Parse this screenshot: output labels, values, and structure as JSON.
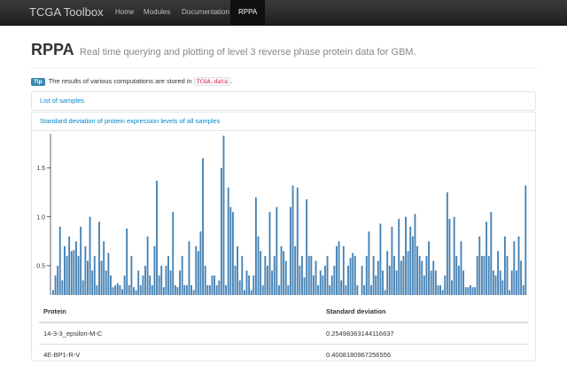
{
  "navbar": {
    "brand": "TCGA Toolbox",
    "items": [
      "Home",
      "Modules",
      "Documentation",
      "RPPA"
    ],
    "active": "RPPA"
  },
  "header": {
    "title": "RPPA",
    "subtitle": "Real time querying and plotting of level 3 reverse phase protein data for GBM."
  },
  "tip": {
    "label": "Tip",
    "text_before": "The results of various computations are stored in",
    "code": "TCGA.data",
    "text_after": "."
  },
  "accordion": {
    "samples_link": "List of samples",
    "stddev_link": "Standard deviation of protein expression levels of all samples"
  },
  "colors": {
    "bar": "#4682b4",
    "link": "#0088cc",
    "navbar": "#222222"
  },
  "chart_data": {
    "type": "bar",
    "title": "",
    "xlabel": "",
    "ylabel": "",
    "ylim": [
      0.2,
      1.85
    ],
    "yticks": [
      "0.5",
      "1.0",
      "1.5"
    ],
    "ytick_values": [
      0.5,
      1.0,
      1.5
    ],
    "values": [
      0.25,
      0.4,
      0.5,
      0.9,
      0.35,
      0.7,
      0.6,
      0.8,
      0.65,
      0.66,
      0.75,
      0.6,
      0.9,
      0.35,
      0.7,
      0.55,
      1.0,
      0.45,
      0.6,
      0.3,
      0.95,
      0.55,
      0.75,
      0.45,
      0.63,
      0.4,
      0.28,
      0.3,
      0.32,
      0.3,
      0.26,
      0.4,
      0.88,
      0.3,
      0.6,
      0.28,
      0.25,
      0.45,
      0.3,
      0.4,
      0.5,
      0.8,
      0.4,
      0.3,
      0.7,
      1.37,
      0.4,
      0.5,
      0.28,
      0.5,
      0.6,
      0.45,
      1.05,
      0.3,
      0.28,
      0.45,
      0.6,
      0.3,
      0.3,
      0.75,
      0.3,
      0.25,
      0.7,
      0.65,
      0.85,
      1.6,
      0.5,
      0.3,
      0.3,
      0.4,
      0.4,
      0.3,
      0.35,
      1.5,
      1.83,
      0.3,
      1.3,
      1.1,
      1.05,
      0.5,
      0.7,
      0.35,
      0.6,
      0.25,
      0.45,
      0.4,
      0.25,
      0.4,
      1.2,
      0.8,
      0.65,
      0.3,
      0.6,
      0.5,
      1.05,
      0.45,
      0.6,
      1.1,
      0.3,
      0.7,
      0.65,
      0.55,
      0.3,
      1.1,
      1.32,
      0.7,
      1.3,
      0.5,
      0.6,
      0.38,
      1.18,
      0.6,
      0.6,
      0.4,
      0.55,
      0.3,
      0.45,
      0.4,
      0.5,
      0.6,
      0.3,
      0.4,
      0.5,
      0.7,
      0.75,
      0.35,
      0.7,
      0.3,
      0.5,
      0.58,
      0.63,
      0.6,
      0.3,
      0.2,
      0.5,
      0.3,
      0.6,
      0.85,
      0.3,
      0.6,
      0.4,
      0.55,
      0.93,
      0.45,
      0.25,
      0.65,
      0.5,
      0.9,
      0.6,
      0.45,
      0.98,
      0.55,
      0.6,
      1.0,
      0.65,
      0.9,
      0.8,
      1.03,
      0.7,
      0.6,
      0.55,
      0.4,
      0.6,
      0.75,
      0.45,
      0.55,
      0.45,
      0.3,
      0.3,
      0.25,
      0.4,
      1.25,
      0.98,
      0.35,
      1.0,
      0.6,
      0.5,
      0.75,
      0.45,
      0.28,
      0.28,
      0.3,
      0.28,
      0.28,
      0.6,
      0.8,
      0.6,
      0.6,
      0.95,
      0.6,
      1.05,
      0.45,
      0.4,
      0.65,
      0.45,
      0.35,
      0.8,
      0.6,
      0.25,
      0.45,
      0.75,
      0.45,
      0.8,
      0.55,
      0.3,
      1.32
    ]
  },
  "table": {
    "headers": [
      "Protein",
      "Standard deviation"
    ],
    "rows": [
      [
        "14-3-3_epsilon-M-C",
        "0.25498363144116637"
      ],
      [
        "4E-BP1-R-V",
        "0.4008180967256556"
      ]
    ]
  }
}
